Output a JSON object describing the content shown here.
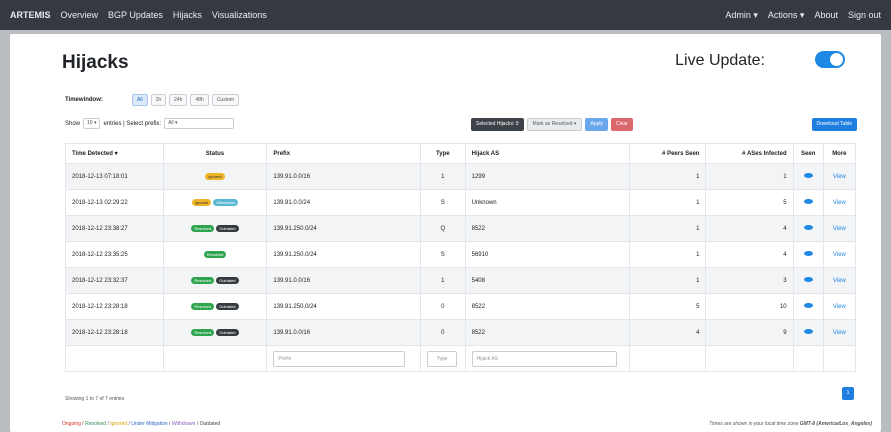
{
  "nav": {
    "left_items": [
      "ARTEMIS",
      "Overview",
      "BGP Updates",
      "Hijacks",
      "Visualizations"
    ],
    "right_items": [
      "Admin ▾",
      "Actions ▾",
      "About",
      "Sign out"
    ]
  },
  "page": {
    "title": "Hijacks",
    "live_update_label": "Live Update:"
  },
  "timewindow": {
    "label": "Timewindow:",
    "options": [
      "All",
      "1h",
      "24h",
      "48h",
      "Custom"
    ]
  },
  "controls": {
    "show_label": "Show",
    "entries_value": "10 ▾",
    "entries_label": "entries | Select prefix:",
    "prefix_value": "All ▾",
    "selected_hijacks": "Selected Hijacks: 0",
    "mark_as": "Mark as Resolved ▾",
    "apply": "Apply",
    "clear": "Clear",
    "download": "Download Table"
  },
  "table": {
    "headers": [
      "Time Detected ▾",
      "Status",
      "Prefix",
      "Type",
      "Hijack AS",
      "# Peers Seen",
      "# ASes Infected",
      "Seen",
      "More"
    ],
    "rows": [
      {
        "time": "2018-12-13 07:18:01",
        "status": [
          "Ignored"
        ],
        "prefix": "139.91.0.0/16",
        "type": "1",
        "as": "1299",
        "peers": "1",
        "ases": "1",
        "more": "View"
      },
      {
        "time": "2018-12-13 02:29:22",
        "status": [
          "Ignored",
          "Withdrawn"
        ],
        "prefix": "139.91.0.0/24",
        "type": "S",
        "as": "Unknown",
        "peers": "1",
        "ases": "5",
        "more": "View"
      },
      {
        "time": "2018-12-12 23:38:27",
        "status": [
          "Resolved",
          "Outdated"
        ],
        "prefix": "139.91.250.0/24",
        "type": "Q",
        "as": "8522",
        "peers": "1",
        "ases": "4",
        "more": "View"
      },
      {
        "time": "2018-12-12 23:35:25",
        "status": [
          "Resolved"
        ],
        "prefix": "139.91.250.0/24",
        "type": "S",
        "as": "56910",
        "peers": "1",
        "ases": "4",
        "more": "View"
      },
      {
        "time": "2018-12-12 23:32:37",
        "status": [
          "Resolved",
          "Outdated"
        ],
        "prefix": "139.91.0.0/16",
        "type": "1",
        "as": "5408",
        "peers": "1",
        "ases": "3",
        "more": "View"
      },
      {
        "time": "2018-12-12 23:28:18",
        "status": [
          "Resolved",
          "Outdated"
        ],
        "prefix": "139.91.250.0/24",
        "type": "0",
        "as": "8522",
        "peers": "5",
        "ases": "10",
        "more": "View"
      },
      {
        "time": "2018-12-12 23:28:18",
        "status": [
          "Resolved",
          "Outdated"
        ],
        "prefix": "139.91.0.0/16",
        "type": "0",
        "as": "8522",
        "peers": "4",
        "ases": "9",
        "more": "View"
      }
    ],
    "filters": {
      "prefix": "Prefix",
      "type": "Type",
      "hijack_as": "Hijack AS"
    }
  },
  "footer": {
    "showing": "Showing 1 to 7 of 7 entries",
    "page": "1",
    "legend": [
      "Ongoing",
      "Resolved",
      "Ignored",
      "Under Mitigation",
      "Withdrawn",
      "Outdated"
    ],
    "legend_separator": " / ",
    "timezone_prefix": "Times are shown in your local time zone ",
    "timezone_value": "GMT-8 (America/Los_Angeles)"
  },
  "colors": {
    "navbar": "#343a40",
    "accent": "#1e88e5",
    "ignored": "#f0b429",
    "withdrawn": "#58b8d4",
    "resolved": "#2ea44f",
    "outdated": "#343a40",
    "clear": "#d9676c"
  },
  "icons": {
    "seen": "eye-icon",
    "sort": "sort-icon"
  }
}
